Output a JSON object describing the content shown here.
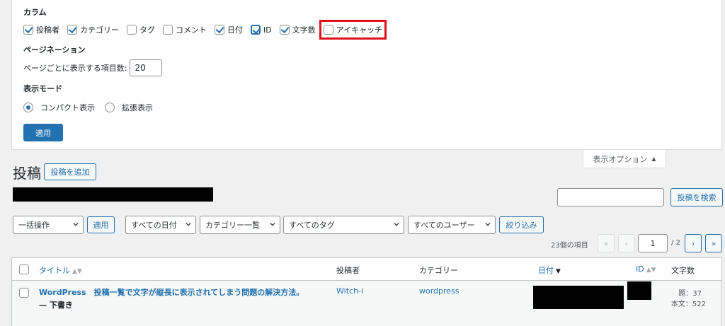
{
  "screen_options": {
    "columns_heading": "カラム",
    "columns": [
      {
        "label": "投稿者",
        "checked": true
      },
      {
        "label": "カテゴリー",
        "checked": true
      },
      {
        "label": "タグ",
        "checked": false
      },
      {
        "label": "コメント",
        "checked": false
      },
      {
        "label": "日付",
        "checked": true
      },
      {
        "label": "ID",
        "checked": true
      },
      {
        "label": "文字数",
        "checked": true
      },
      {
        "label": "アイキャッチ",
        "checked": false
      }
    ],
    "pagination_heading": "ページネーション",
    "per_page_label": "ページごとに表示する項目数:",
    "per_page_value": "20",
    "view_mode_heading": "表示モード",
    "view_modes": [
      {
        "label": "コンパクト表示",
        "checked": true
      },
      {
        "label": "拡張表示",
        "checked": false
      }
    ],
    "apply_label": "適用",
    "tab_label": "表示オプション",
    "tab_arrow": "▲",
    "highlight_color": "#e0101a"
  },
  "header": {
    "title": "投稿",
    "add_new_label": "投稿を追加",
    "search_button_label": "投稿を検索"
  },
  "filters": {
    "bulk_action": "一括操作",
    "bulk_apply": "適用",
    "dates": "すべての日付",
    "categories": "カテゴリー一覧",
    "tags": "すべてのタグ",
    "users": "すべてのユーザー",
    "filter_button": "絞り込み"
  },
  "pagination": {
    "items_count": "23個の項目",
    "first": "«",
    "prev": "‹",
    "current_page": "1",
    "total": "/ 2",
    "next": "›",
    "last": "»"
  },
  "table": {
    "columns": {
      "title": "タイトル",
      "author": "投稿者",
      "category": "カテゴリー",
      "date": "日付",
      "id": "ID",
      "word_count": "文字数"
    },
    "rows": [
      {
        "title": "WordPress　投稿一覧で文字が縦長に表示されてしまう問題の解決方法。",
        "state": "— 下書き",
        "author": "Witch-i",
        "category": "wordpress",
        "title_count": "題：37",
        "body_count": "本文：522"
      }
    ]
  },
  "colors": {
    "primary": "#2271b1",
    "background": "#f0f0f1",
    "text": "#1d2327"
  }
}
